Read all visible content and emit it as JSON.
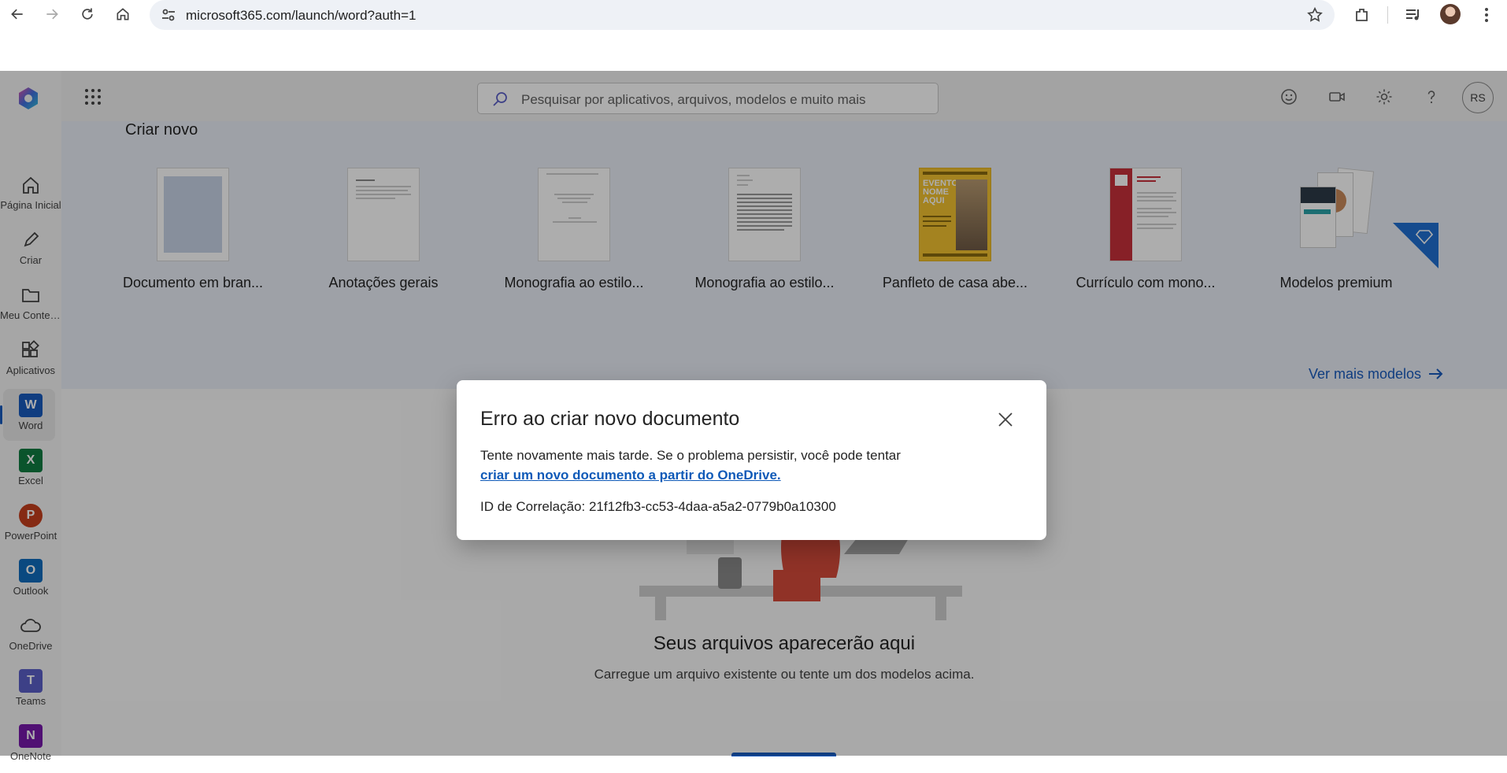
{
  "browser": {
    "url": "microsoft365.com/launch/word?auth=1"
  },
  "rail": {
    "items": [
      {
        "label": "Página Inicial"
      },
      {
        "label": "Criar"
      },
      {
        "label": "Meu Conteúdo"
      },
      {
        "label": "Aplicativos"
      },
      {
        "label": "Word",
        "tile": "W",
        "color": "#185abd"
      },
      {
        "label": "Excel",
        "tile": "X",
        "color": "#107c41"
      },
      {
        "label": "PowerPoint",
        "tile": "P",
        "color": "#c43e1c"
      },
      {
        "label": "Outlook",
        "tile": "O",
        "color": "#0f6cbd"
      },
      {
        "label": "OneDrive"
      },
      {
        "label": "Teams",
        "tile": "T",
        "color": "#5b5fc7"
      },
      {
        "label": "OneNote",
        "tile": "N",
        "color": "#7719aa"
      }
    ]
  },
  "header": {
    "search_placeholder": "Pesquisar por aplicativos, arquivos, modelos e muito mais",
    "avatar_initials": "RS"
  },
  "create": {
    "title": "Criar novo",
    "templates": [
      {
        "name": "Documento em bran..."
      },
      {
        "name": "Anotações gerais"
      },
      {
        "name": "Monografia ao estilo..."
      },
      {
        "name": "Monografia ao estilo..."
      },
      {
        "name": "Panfleto de casa abe..."
      },
      {
        "name": "Currículo com mono..."
      },
      {
        "name": "Modelos premium"
      }
    ],
    "see_more": "Ver mais modelos",
    "flyer_text": "EVENTO NOME AQUI"
  },
  "files": {
    "title": "Seus arquivos aparecerão aqui",
    "subtitle": "Carregue um arquivo existente ou tente um dos modelos acima."
  },
  "dialog": {
    "title": "Erro ao criar novo documento",
    "body_text": "Tente novamente mais tarde. Se o problema persistir, você pode tentar",
    "link_text": "criar um novo documento a partir do OneDrive.",
    "correlation": "ID de Correlação: 21f12fb3-cc53-4daa-a5a2-0779b0a10300"
  },
  "colors": {
    "accent": "#185abd",
    "link": "#0f5ab8"
  }
}
